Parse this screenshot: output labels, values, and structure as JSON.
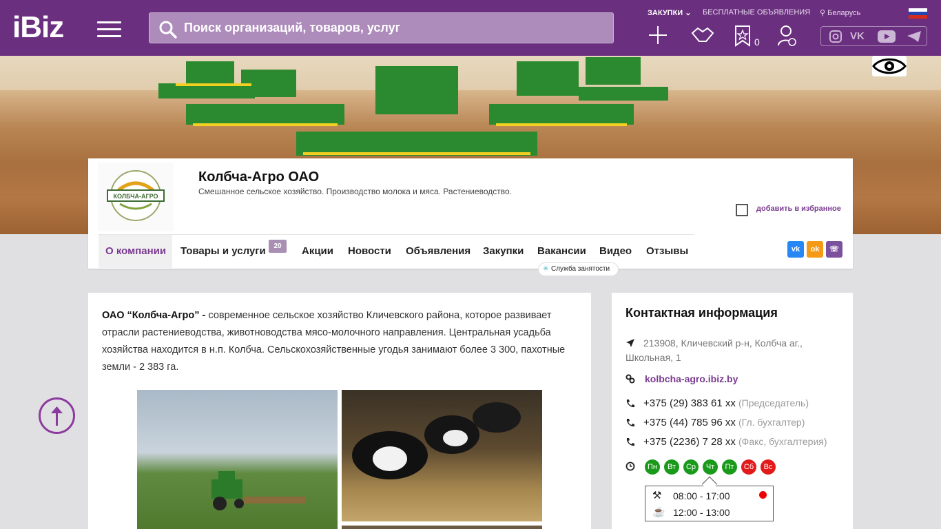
{
  "header": {
    "logo": "iBiz",
    "search_placeholder": "Поиск организаций, товаров, услуг",
    "links": {
      "purchases": "ЗАКУПКИ",
      "free_ads": "БЕСПЛАТНЫЕ ОБЪЯВЛЕНИЯ",
      "region": "Беларусь"
    },
    "favorites_count": "0"
  },
  "company": {
    "name": "Колбча-Агро ОАО",
    "description": "Смешанное сельское хозяйство. Производство молока и мяса. Растениеводство.",
    "logo_text": "КОЛБЧА-АГРО",
    "add_favorite": "добавить в избранное"
  },
  "nav": {
    "items": [
      "О компании",
      "Товары и услуги",
      "Акции",
      "Новости",
      "Объявления",
      "Закупки",
      "Вакансии",
      "Видео",
      "Отзывы"
    ],
    "goods_badge": "20",
    "tooltip": "Служба занятости"
  },
  "about": {
    "bold_intro": "ОАО “Колбча-Агро” -",
    "text": " современное сельское хозяйство Кличевского района, которое развивает отрасли растениеводства, животноводства мясо-молочного направления. Центральная усадьба хозяйства находится в н.п. Колбча. Сельскохозяйственные угодья занимают более 3 300, пахотные земли - 2 383 га."
  },
  "contact": {
    "title": "Контактная информация",
    "address_line1": "213908, Кличевский р-н, Колбча аг.,",
    "address_line2": "Школьная, 1",
    "website": "kolbcha-agro.ibiz.by",
    "phones": [
      {
        "number": "+375 (29) 383 61 xx",
        "note": "(Председатель)"
      },
      {
        "number": "+375 (44) 785 96 xx",
        "note": "(Гл. бухгалтер)"
      },
      {
        "number": "+375 (2236) 7 28 xx",
        "note": "(Факс, бухгалтерия)"
      }
    ],
    "days": [
      "Пн",
      "Вт",
      "Ср",
      "Чт",
      "Пт",
      "Сб",
      "Вс"
    ],
    "work_hours": "08:00 - 17:00",
    "break_hours": "12:00 - 13:00"
  },
  "colors": {
    "brand": "#6b2f7f",
    "workday": "#1a9a1a",
    "weekend": "#e21a1a"
  }
}
